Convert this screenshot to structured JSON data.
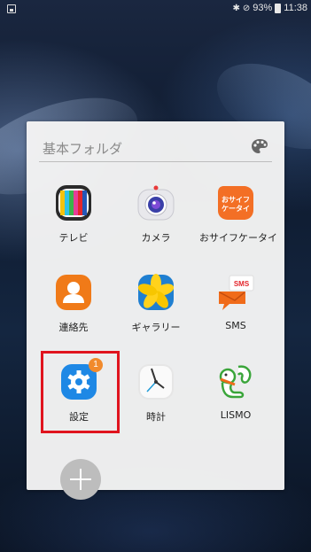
{
  "status_bar": {
    "battery": "93%",
    "time": "11:38",
    "icons": [
      "notification-icon",
      "bluetooth-icon",
      "do-not-disturb-icon",
      "battery-icon"
    ]
  },
  "folder": {
    "name": "基本フォルダ",
    "palette_icon": "palette-icon",
    "apps": [
      {
        "label": "テレビ",
        "icon": "tv-icon"
      },
      {
        "label": "カメラ",
        "icon": "camera-icon"
      },
      {
        "label": "おサイフケータイ",
        "icon": "osaifu-keitai-icon",
        "icon_text": "おサイフ\nケータイ"
      },
      {
        "label": "連絡先",
        "icon": "contacts-icon"
      },
      {
        "label": "ギャラリー",
        "icon": "gallery-icon"
      },
      {
        "label": "SMS",
        "icon": "sms-icon",
        "icon_text": "SMS"
      },
      {
        "label": "設定",
        "icon": "settings-icon",
        "badge": "1"
      },
      {
        "label": "時計",
        "icon": "clock-icon"
      },
      {
        "label": "LISMO",
        "icon": "lismo-icon"
      }
    ],
    "add_button_icon": "plus-icon"
  },
  "colors": {
    "highlight": "#e0141e",
    "badge": "#f18a2c",
    "settings_blue": "#1e88e5",
    "contacts_orange": "#f07a18"
  }
}
